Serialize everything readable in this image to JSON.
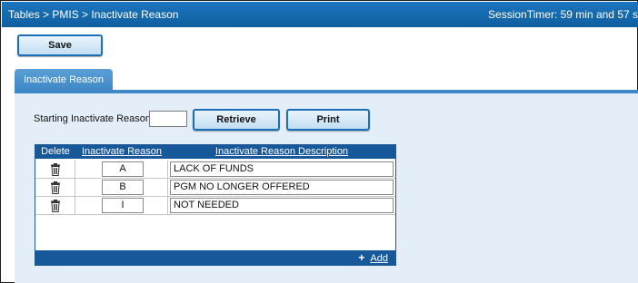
{
  "header": {
    "breadcrumb": "Tables > PMIS > Inactivate Reason",
    "session_timer": "SessionTimer: 59 min and 57 s"
  },
  "toolbar": {
    "save_label": "Save"
  },
  "tabs": [
    {
      "label": "Inactivate Reason",
      "active": true
    }
  ],
  "filter": {
    "label": "Starting Inactivate Reason:",
    "value": "",
    "retrieve_label": "Retrieve",
    "print_label": "Print"
  },
  "grid": {
    "columns": {
      "delete": "Delete",
      "reason": "Inactivate Reason",
      "description": "Inactivate Reason Description"
    },
    "rows": [
      {
        "reason": "A",
        "description": "LACK OF FUNDS"
      },
      {
        "reason": "B",
        "description": "PGM NO LONGER OFFERED"
      },
      {
        "reason": "I",
        "description": "NOT NEEDED"
      }
    ],
    "add_label": "Add",
    "add_icon": "plus-icon",
    "delete_icon": "trash-icon"
  },
  "colors": {
    "titlebar": "#1c75bd",
    "tab": "#3f87c6",
    "panel": "#e4eef8",
    "grid_header": "#17589a",
    "button_border": "#1b6fb4"
  }
}
